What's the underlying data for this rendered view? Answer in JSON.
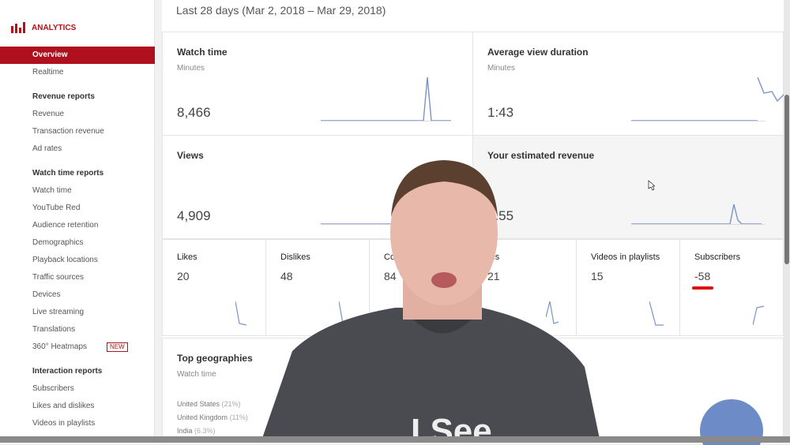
{
  "sidebar": {
    "brand": "ANALYTICS",
    "items": [
      {
        "label": "Overview",
        "type": "active"
      },
      {
        "label": "Realtime"
      },
      {
        "label": "Revenue reports",
        "type": "head"
      },
      {
        "label": "Revenue"
      },
      {
        "label": "Transaction revenue"
      },
      {
        "label": "Ad rates"
      },
      {
        "label": "Watch time reports",
        "type": "head"
      },
      {
        "label": "Watch time"
      },
      {
        "label": "YouTube Red"
      },
      {
        "label": "Audience retention"
      },
      {
        "label": "Demographics"
      },
      {
        "label": "Playback locations"
      },
      {
        "label": "Traffic sources"
      },
      {
        "label": "Devices"
      },
      {
        "label": "Live streaming"
      },
      {
        "label": "Translations"
      },
      {
        "label": "360° Heatmaps",
        "badge": "NEW"
      },
      {
        "label": "Interaction reports",
        "type": "head"
      },
      {
        "label": "Subscribers"
      },
      {
        "label": "Likes and dislikes"
      },
      {
        "label": "Videos in playlists"
      }
    ]
  },
  "main": {
    "date_range": "Last 28 days (Mar 2, 2018 – Mar 29, 2018)",
    "big_cards": [
      {
        "title": "Watch time",
        "subtitle": "Minutes",
        "value": "8,466"
      },
      {
        "title": "Average view duration",
        "subtitle": "Minutes",
        "value": "1:43"
      },
      {
        "title": "Views",
        "subtitle": "",
        "value": "4,909"
      },
      {
        "title": "Your estimated revenue",
        "subtitle": "",
        "value": "1.55"
      }
    ],
    "small_cards": [
      {
        "title": "Likes",
        "value": "20"
      },
      {
        "title": "Dislikes",
        "value": "48"
      },
      {
        "title": "Co",
        "value": "84"
      },
      {
        "title": "res",
        "value": "21"
      },
      {
        "title": "Videos in playlists",
        "value": "15"
      },
      {
        "title": "Subscribers",
        "value": "-58"
      }
    ],
    "geographies": {
      "title": "Top geographies",
      "subtitle": "Watch time",
      "rows": [
        {
          "country": "United States",
          "pct": "(21%)"
        },
        {
          "country": "United Kingdom",
          "pct": "(11%)"
        },
        {
          "country": "India",
          "pct": "(6.3%)"
        }
      ]
    }
  },
  "overlay": {
    "shirt_text": "I See"
  },
  "colors": {
    "accent": "#b0101e",
    "sparkline": "#7b93c9",
    "pie": "#6d8cc7"
  }
}
